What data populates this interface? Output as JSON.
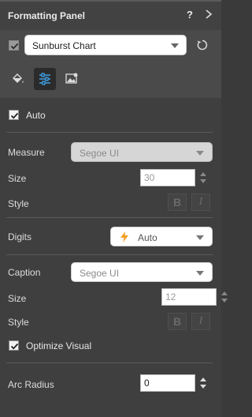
{
  "panel": {
    "title": "Formatting Panel",
    "help": "?"
  },
  "chart_select": {
    "checked": true,
    "value": "Sunburst Chart"
  },
  "tabs": [
    {
      "icon": "paint-bucket-icon",
      "active": false
    },
    {
      "icon": "sliders-icon",
      "active": true
    },
    {
      "icon": "image-settings-icon",
      "active": false
    }
  ],
  "auto": {
    "label": "Auto",
    "checked": true
  },
  "measure": {
    "label": "Measure",
    "font": "Segoe UI",
    "size_label": "Size",
    "size": "30",
    "style_label": "Style",
    "bold": "B",
    "italic": "I"
  },
  "digits": {
    "label": "Digits",
    "value": "Auto"
  },
  "caption": {
    "label": "Caption",
    "font": "Segoe UI",
    "size_label": "Size",
    "size": "12",
    "style_label": "Style",
    "bold": "B",
    "italic": "I"
  },
  "optimize": {
    "label": "Optimize Visual",
    "checked": true
  },
  "arc_radius": {
    "label": "Arc Radius",
    "value": "0"
  },
  "colors": {
    "accent": "#3fa9f5",
    "bolt": "#f0a020"
  }
}
